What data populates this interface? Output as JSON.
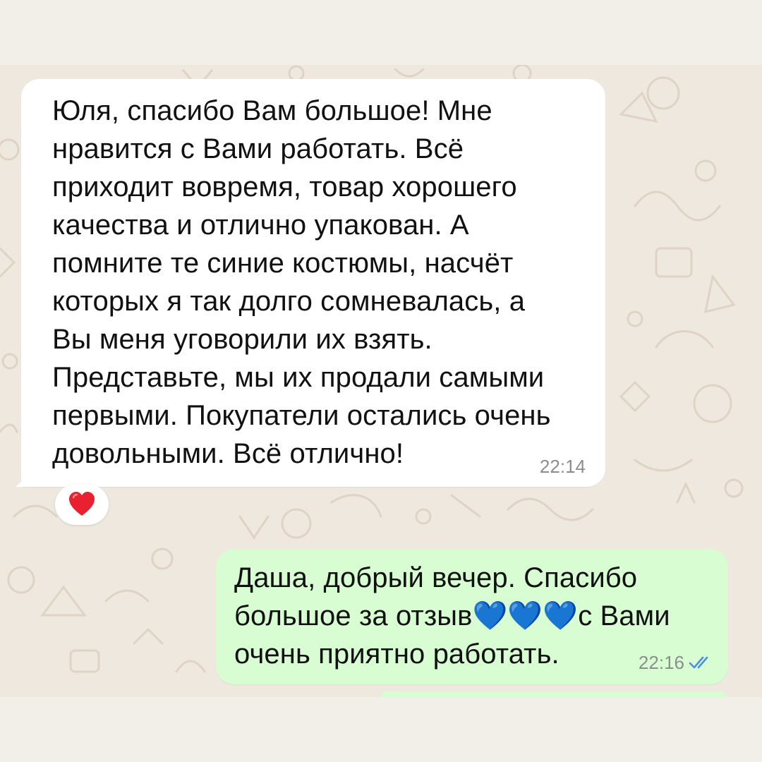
{
  "colors": {
    "chat_background": "#efe8de",
    "incoming_bubble": "#ffffff",
    "outgoing_bubble": "#d9fdd3",
    "read_ticks": "#4a90e2",
    "timestamp": "#8d8d8d"
  },
  "messages": [
    {
      "direction": "incoming",
      "lines": [
        "Юля, спасибо Вам большое! Мне",
        "нравится с Вами работать. Всё",
        "приходит вовремя, товар хорошего",
        "качества и отлично упакован.  А",
        "помните те синие костюмы, насчёт",
        "которых я так долго сомневалась, а",
        "Вы меня уговорили их взять.",
        "Представьте, мы их продали самыми",
        "первыми. Покупатели остались очень",
        "довольными. Всё отлично!"
      ],
      "time": "22:14",
      "reaction": "❤️",
      "reaction_icon": "red-heart-icon"
    },
    {
      "direction": "outgoing",
      "lines": [
        "Даша, добрый вечер. Спасибо",
        "большое за отзыв💙💙💙с Вами",
        "очень приятно работать."
      ],
      "time": "22:16",
      "status_icon": "double-check-read-icon"
    }
  ]
}
